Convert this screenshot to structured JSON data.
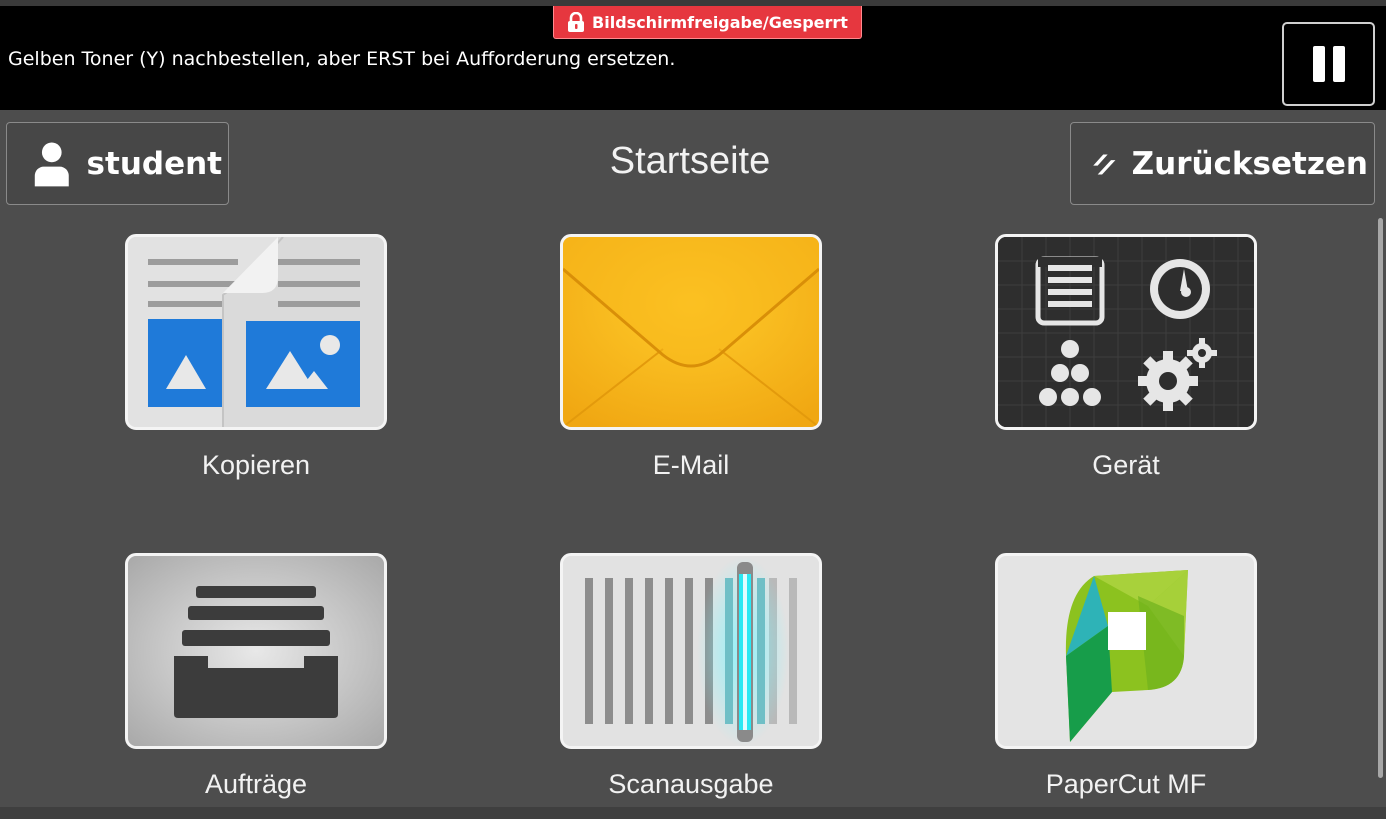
{
  "status_bar": {
    "message": "Gelben Toner (Y) nachbestellen, aber ERST bei Aufforderung ersetzen.",
    "lock_badge": "Bildschirmfreigabe/Gesperrt",
    "pause_icon": "pause-icon"
  },
  "header": {
    "user_label": "student",
    "user_icon": "user-icon",
    "title": "Startseite",
    "reset_label": "Zurücksetzen",
    "reset_icon": "reset-icon"
  },
  "apps": [
    {
      "label": "Kopieren",
      "icon": "copy-icon"
    },
    {
      "label": "E-Mail",
      "icon": "email-icon"
    },
    {
      "label": "Gerät",
      "icon": "device-icon"
    },
    {
      "label": "Aufträge",
      "icon": "jobs-icon"
    },
    {
      "label": "Scanausgabe",
      "icon": "scan-icon"
    },
    {
      "label": "PaperCut MF",
      "icon": "papercut-icon"
    }
  ],
  "colors": {
    "background": "#4d4d4d",
    "status_bar": "#000000",
    "lock_badge": "#e6373f",
    "email_envelope": "#f5b51b",
    "scan_light": "#22e3ef",
    "papercut_green": "#8cc21f"
  }
}
